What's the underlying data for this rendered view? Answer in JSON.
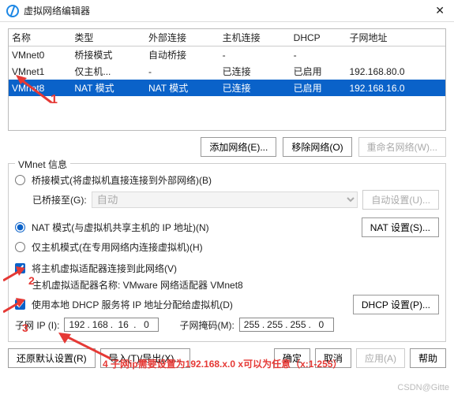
{
  "window": {
    "title": "虚拟网络编辑器"
  },
  "table": {
    "headers": [
      "名称",
      "类型",
      "外部连接",
      "主机连接",
      "DHCP",
      "子网地址"
    ],
    "rows": [
      {
        "name": "VMnet0",
        "type": "桥接模式",
        "ext": "自动桥接",
        "host": "-",
        "dhcp": "-",
        "subnet": ""
      },
      {
        "name": "VMnet1",
        "type": "仅主机...",
        "ext": "-",
        "host": "已连接",
        "dhcp": "已启用",
        "subnet": "192.168.80.0"
      },
      {
        "name": "VMnet8",
        "type": "NAT 模式",
        "ext": "NAT 模式",
        "host": "已连接",
        "dhcp": "已启用",
        "subnet": "192.168.16.0"
      }
    ]
  },
  "buttons": {
    "addNet": "添加网络(E)...",
    "removeNet": "移除网络(O)",
    "renameNet": "重命名网络(W)...",
    "autoSet": "自动设置(U)...",
    "natSet": "NAT 设置(S)...",
    "dhcpSet": "DHCP 设置(P)..."
  },
  "group": {
    "legend": "VMnet 信息",
    "bridgeLabel": "桥接模式(将虚拟机直接连接到外部网络)(B)",
    "bridgeToLabel": "已桥接至(G):",
    "bridgeToValue": "自动",
    "natLabel": "NAT 模式(与虚拟机共享主机的 IP 地址)(N)",
    "hostOnlyLabel": "仅主机模式(在专用网络内连接虚拟机)(H)",
    "connectHostLabel": "将主机虚拟适配器连接到此网络(V)",
    "adapterNameLabel": "主机虚拟适配器名称: VMware 网络适配器 VMnet8",
    "useDhcpLabel": "使用本地 DHCP 服务将 IP 地址分配给虚拟机(D)",
    "subnetIpLabel": "子网 IP (I):",
    "subnetIp": [
      "192",
      "168",
      "16",
      "0"
    ],
    "subnetMaskLabel": "子网掩码(M):",
    "subnetMask": [
      "255",
      "255",
      "255",
      "0"
    ]
  },
  "bottom": {
    "restore": "还原默认设置(R)",
    "importExport": "导入(T)/导出(X)...",
    "ok": "确定",
    "cancel": "取消",
    "apply": "应用(A)",
    "help": "帮助"
  },
  "annotations": {
    "a1": "1",
    "a2": "2",
    "a3": "3",
    "a4": "4 子网ip需要设置为192.168.x.0   x可以为任意（x:1-255）"
  },
  "watermark": "CSDN@Gitte"
}
